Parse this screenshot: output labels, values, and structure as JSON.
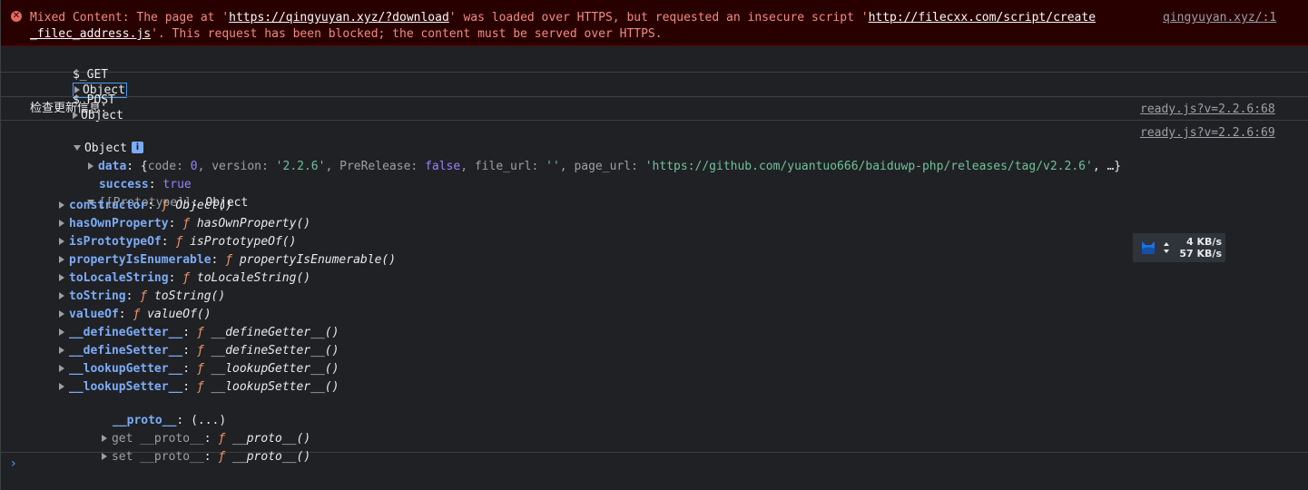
{
  "error": {
    "prefix": "Mixed Content: The page at '",
    "page_url": "https://qingyuyan.xyz/?download",
    "middle": "' was loaded over HTTPS, but requested an insecure script '",
    "script_url_part1": "http://filecxx.com/script/create",
    "script_url_part2": "_filec_address.js",
    "suffix": "'. This request has been blocked; the content must be served over HTTPS.",
    "source": "qingyuyan.xyz/:1"
  },
  "get_row": {
    "label": "$_GET",
    "value": "Object"
  },
  "post_row": {
    "label": "$_POST",
    "value": "Object"
  },
  "update_row": {
    "label": "检查更新信息：",
    "source": "ready.js?v=2.2.6:68"
  },
  "object_row": {
    "label": "Object",
    "info": "i",
    "source": "ready.js?v=2.2.6:69",
    "data_line": {
      "key": "data",
      "open": ": {",
      "code_key": "code",
      "code_val": "0",
      "version_key": "version",
      "version_val": "'2.2.6'",
      "prerelease_key": "PreRelease",
      "prerelease_val": "false",
      "fileurl_key": "file_url",
      "fileurl_val": "''",
      "pageurl_key": "page_url",
      "pageurl_val": "'https://github.com/yuantuo666/baiduwp-php/releases/tag/v2.2.6'",
      "close": ", …}"
    },
    "success_line": {
      "key": "success",
      "value": "true"
    },
    "prototype_line": {
      "key": "[[Prototype]]",
      "value": "Object"
    },
    "proto_members": [
      {
        "name": "constructor",
        "fn": "Object()"
      },
      {
        "name": "hasOwnProperty",
        "fn": "hasOwnProperty()"
      },
      {
        "name": "isPrototypeOf",
        "fn": "isPrototypeOf()"
      },
      {
        "name": "propertyIsEnumerable",
        "fn": "propertyIsEnumerable()"
      },
      {
        "name": "toLocaleString",
        "fn": "toLocaleString()"
      },
      {
        "name": "toString",
        "fn": "toString()"
      },
      {
        "name": "valueOf",
        "fn": "valueOf()"
      },
      {
        "name": "__defineGetter__",
        "fn": "__defineGetter__()"
      },
      {
        "name": "__defineSetter__",
        "fn": "__defineSetter__()"
      },
      {
        "name": "__lookupGetter__",
        "fn": "__lookupGetter__()"
      },
      {
        "name": "__lookupSetter__",
        "fn": "__lookupSetter__()"
      }
    ],
    "proto_accessor": {
      "name": "__proto__",
      "value": "(...)"
    },
    "getter_line": {
      "prefix": "get",
      "name": "__proto__",
      "fn": "__proto__()"
    },
    "setter_line": {
      "prefix": "set",
      "name": "__proto__",
      "fn": "__proto__()"
    },
    "f_symbol": "ƒ"
  },
  "prompt": "›",
  "speed_widget": {
    "upload": "4 KB/s",
    "download": "57 KB/s"
  }
}
